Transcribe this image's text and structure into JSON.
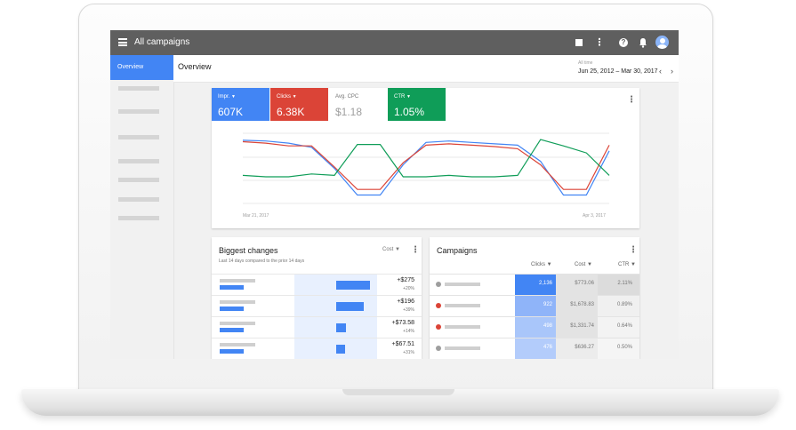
{
  "topbar": {
    "title": "All campaigns",
    "icons": [
      "menu-icon",
      "report-icon",
      "more-vert-icon",
      "help-icon",
      "notifications-icon",
      "account-icon"
    ]
  },
  "sidebar": {
    "active_item": "Overview"
  },
  "overview": {
    "title": "Overview",
    "date_range_label": "All time",
    "date_range": "Jun 25, 2012 – Mar 30, 2017",
    "prev_icon": "‹",
    "next_icon": "›"
  },
  "metrics": [
    {
      "label": "Impr.",
      "value": "607K",
      "color": "#4285f4",
      "selected": true
    },
    {
      "label": "Clicks",
      "value": "6.38K",
      "color": "#db4437",
      "selected": true
    },
    {
      "label": "Avg. CPC",
      "value": "$1.18",
      "color": "#ffffff",
      "selected": false
    },
    {
      "label": "CTR",
      "value": "1.05%",
      "color": "#0f9d58",
      "selected": true
    }
  ],
  "chart_data": {
    "type": "line",
    "x_start_label": "Mar 21, 2017",
    "x_end_label": "Apr 3, 2017",
    "ylim": [
      0,
      100
    ],
    "grid": true,
    "series": [
      {
        "name": "Impr.",
        "color": "#4285f4",
        "values": [
          90,
          89,
          86,
          80,
          50,
          12,
          12,
          55,
          87,
          89,
          87,
          85,
          83,
          60,
          12,
          12,
          75
        ]
      },
      {
        "name": "Clicks",
        "color": "#db4437",
        "values": [
          88,
          86,
          82,
          82,
          52,
          20,
          20,
          58,
          83,
          85,
          83,
          81,
          78,
          55,
          20,
          20,
          83
        ]
      },
      {
        "name": "CTR",
        "color": "#0f9d58",
        "values": [
          40,
          38,
          38,
          42,
          40,
          84,
          84,
          38,
          38,
          40,
          38,
          38,
          40,
          91,
          82,
          72,
          40
        ]
      }
    ]
  },
  "biggest_changes": {
    "title": "Biggest changes",
    "subtitle": "Last 14 days compared to the prior 14 days",
    "filter": "Cost",
    "rows": [
      {
        "delta": "+$275",
        "pct": "+20%",
        "change": 1.0
      },
      {
        "delta": "+$196",
        "pct": "+39%",
        "change": 0.82
      },
      {
        "delta": "+$73.58",
        "pct": "+14%",
        "change": 0.3
      },
      {
        "delta": "+$67.51",
        "pct": "+31%",
        "change": 0.27
      }
    ]
  },
  "campaigns": {
    "title": "Campaigns",
    "columns": [
      "Clicks",
      "Cost",
      "CTR"
    ],
    "rows": [
      {
        "status_color": "#9e9e9e",
        "clicks": "2,136",
        "cost": "$773.06",
        "ctr": "2.11%",
        "clicks_bg": "#4285f4",
        "clicks_fg": "#ffffff",
        "cost_bg": "#e3e3e3",
        "ctr_bg": "#dcdcdc"
      },
      {
        "status_color": "#db4437",
        "clicks": "922",
        "cost": "$1,678.83",
        "ctr": "0.89%",
        "clicks_bg": "#8fb4f9",
        "clicks_fg": "#ffffff",
        "cost_bg": "#e3e3e3",
        "ctr_bg": "#f0f0f0"
      },
      {
        "status_color": "#db4437",
        "clicks": "498",
        "cost": "$1,331.74",
        "ctr": "0.64%",
        "clicks_bg": "#a9c6fa",
        "clicks_fg": "#ffffff",
        "cost_bg": "#e3e3e3",
        "ctr_bg": "#f3f3f3"
      },
      {
        "status_color": "#9e9e9e",
        "clicks": "476",
        "cost": "$636.27",
        "ctr": "0.50%",
        "clicks_bg": "#b3ccfb",
        "clicks_fg": "#ffffff",
        "cost_bg": "#ececec",
        "ctr_bg": "#f5f5f5"
      }
    ]
  }
}
